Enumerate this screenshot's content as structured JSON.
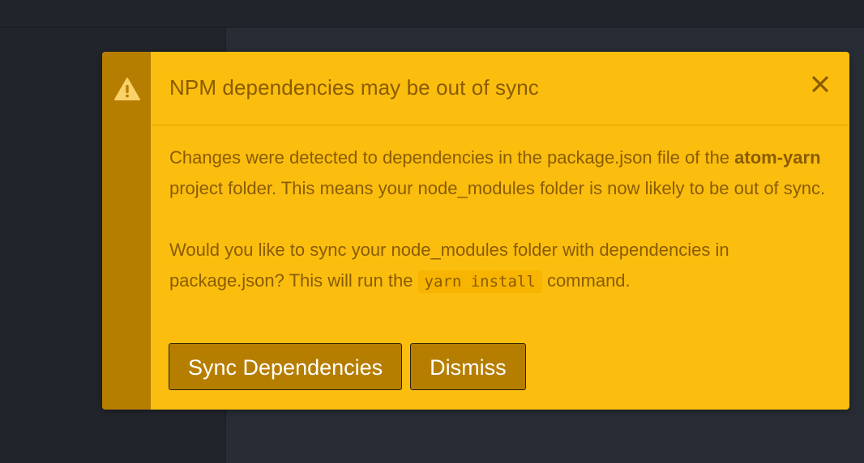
{
  "notification": {
    "type": "warning",
    "icon": "warning-icon",
    "title": "NPM dependencies may be out of sync",
    "close_icon": "close-icon",
    "body": {
      "p1_before": "Changes were detected to dependencies in the package.json file of the ",
      "p1_bold": "atom-yarn",
      "p1_after": " project folder. This means your node_modules folder is now likely to be out of sync.",
      "p2_before": "Would you like to sync your node_modules folder with dependencies in package.json? This will run the ",
      "p2_code": "yarn install",
      "p2_after": " command."
    },
    "buttons": {
      "sync": "Sync Dependencies",
      "dismiss": "Dismiss"
    }
  },
  "colors": {
    "background": "#282c34",
    "notification_bg": "#fbbe0f",
    "stripe": "#b67e00",
    "text": "#8a5c00",
    "button_bg": "#b67e00",
    "button_text": "#ffffff"
  }
}
